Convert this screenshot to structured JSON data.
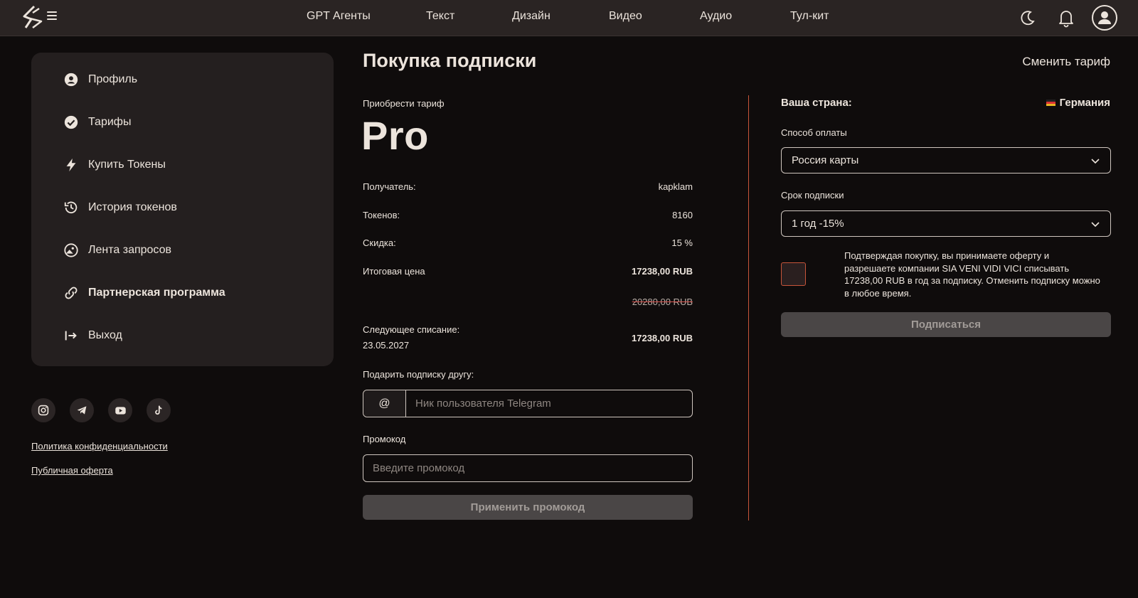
{
  "header": {
    "nav": [
      "GPT Агенты",
      "Текст",
      "Дизайн",
      "Видео",
      "Аудио",
      "Тул-кит"
    ],
    "icons": [
      "logo-icon",
      "menu-icon",
      "moon-icon",
      "bell-icon",
      "user-icon"
    ]
  },
  "sidebar": {
    "items": [
      {
        "label": "Профиль",
        "icon": "profile-icon"
      },
      {
        "label": "Тарифы",
        "icon": "check-circle-icon"
      },
      {
        "label": "Купить Токены",
        "icon": "bolt-icon"
      },
      {
        "label": "История токенов",
        "icon": "history-icon"
      },
      {
        "label": "Лента запросов",
        "icon": "image-icon"
      },
      {
        "label": "Партнерская программа",
        "icon": "link-icon",
        "active": true
      },
      {
        "label": "Выход",
        "icon": "logout-icon"
      }
    ],
    "social": [
      "instagram-icon",
      "telegram-icon",
      "youtube-icon",
      "tiktok-icon"
    ],
    "links": [
      "Политика конфиденциальности",
      "Публичная оферта"
    ]
  },
  "main": {
    "title": "Покупка подписки",
    "change_tariff": "Сменить тариф",
    "plan_label": "Приобрести тариф",
    "plan_name": "Pro",
    "rows": {
      "recipient_label": "Получатель:",
      "recipient_value": "kapklam",
      "tokens_label": "Токенов:",
      "tokens_value": "8160",
      "discount_label": "Скидка:",
      "discount_value": "15 %",
      "total_label": "Итоговая цена",
      "total_value": "17238,00 RUB",
      "old_price": "20280,00 RUB",
      "next_label": "Следующее списание:",
      "next_date": "23.05.2027",
      "next_value": "17238,00 RUB"
    },
    "gift_label": "Подарить подписку другу:",
    "gift_prefix": "@",
    "gift_placeholder": "Ник пользователя Telegram",
    "promo_label": "Промокод",
    "promo_placeholder": "Введите промокод",
    "promo_button": "Применить промокод"
  },
  "right": {
    "country_label": "Ваша страна:",
    "country_value": "Германия",
    "payment_label": "Способ оплаты",
    "payment_value": "Россия карты",
    "term_label": "Срок подписки",
    "term_value": "1 год -15%",
    "consent": "Подтверждая покупку, вы принимаете оферту и разрешаете компании SIA VENI VIDI VICI списывать 17238,00 RUB в год за подписку. Отменить подписку можно в любое время.",
    "subscribe_button": "Подписаться"
  },
  "colors": {
    "background": "#0f0c0c",
    "header": "#2a2423",
    "panel": "#241f1f",
    "text": "#ece4dc",
    "accent": "#c8553a",
    "button": "#4a4646"
  }
}
